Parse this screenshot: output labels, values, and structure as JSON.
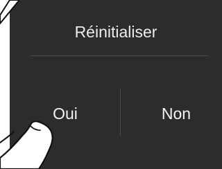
{
  "dialog": {
    "title": "Réinitialiser",
    "yes_label": "Oui",
    "no_label": "Non"
  },
  "icons": {
    "hand": "tap-hand-icon",
    "stylus": "stylus-icon"
  },
  "colors": {
    "panel": "#2b2c2d",
    "text": "#ececec",
    "divider": "#4a4b4d",
    "hand_fill": "#ffffff",
    "hand_stroke": "#111111"
  }
}
